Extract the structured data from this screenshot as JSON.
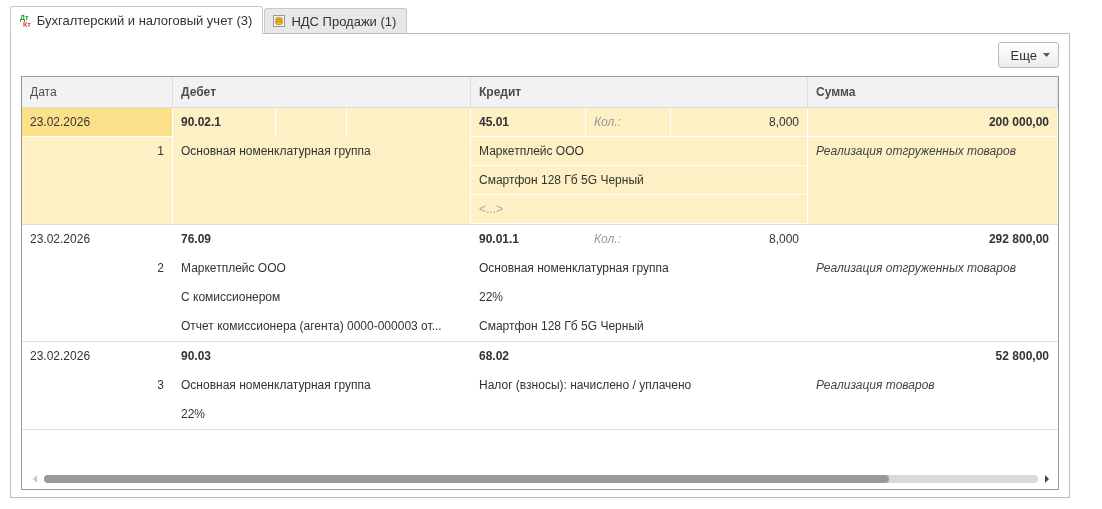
{
  "tabs": [
    {
      "label": "Бухгалтерский и налоговый учет (3)",
      "kind": "dtkt",
      "icon_top": "Дт",
      "icon_bottom": "Кт",
      "selected": true
    },
    {
      "label": "НДС Продажи (1)",
      "kind": "coins",
      "selected": false
    }
  ],
  "more_button": {
    "label": "Еще"
  },
  "table": {
    "columns": [
      "Дата",
      "Дебет",
      "Кредит",
      "Сумма"
    ],
    "rows": [
      {
        "selected": true,
        "date": "23.02.2026",
        "number": "1",
        "debit": {
          "account": "90.02.1",
          "lines": [
            {
              "kind": "text",
              "text": "Основная номенклатурная группа"
            }
          ]
        },
        "credit": {
          "account": "45.01",
          "qty_label": "Кол.:",
          "qty": "8,000",
          "lines": [
            {
              "kind": "text",
              "text": "Маркетплейс ООО"
            },
            {
              "kind": "text",
              "text": "Смартфон 128 Гб 5G Черный"
            },
            {
              "kind": "empty",
              "text": "<...>"
            }
          ]
        },
        "amount": "200 000,00",
        "content": "Реализация отгруженных товаров"
      },
      {
        "selected": false,
        "date": "23.02.2026",
        "number": "2",
        "debit": {
          "account": "76.09",
          "lines": [
            {
              "kind": "text",
              "text": "Маркетплейс ООО"
            },
            {
              "kind": "text",
              "text": "С комиссионером"
            },
            {
              "kind": "text",
              "text": "Отчет комиссионера (агента) 0000-000003 от..."
            }
          ]
        },
        "credit": {
          "account": "90.01.1",
          "qty_label": "Кол.:",
          "qty": "8,000",
          "lines": [
            {
              "kind": "text",
              "text": "Основная номенклатурная группа"
            },
            {
              "kind": "text",
              "text": "22%"
            },
            {
              "kind": "text",
              "text": "Смартфон 128 Гб 5G Черный"
            }
          ]
        },
        "amount": "292 800,00",
        "content": "Реализация отгруженных товаров"
      },
      {
        "selected": false,
        "date": "23.02.2026",
        "number": "3",
        "debit": {
          "account": "90.03",
          "lines": [
            {
              "kind": "text",
              "text": "Основная номенклатурная группа"
            },
            {
              "kind": "text",
              "text": "22%"
            }
          ]
        },
        "credit": {
          "account": "68.02",
          "lines": [
            {
              "kind": "text",
              "text": "Налог (взносы): начислено / уплачено"
            }
          ]
        },
        "amount": "52 800,00",
        "content": "Реализация товаров"
      }
    ]
  }
}
